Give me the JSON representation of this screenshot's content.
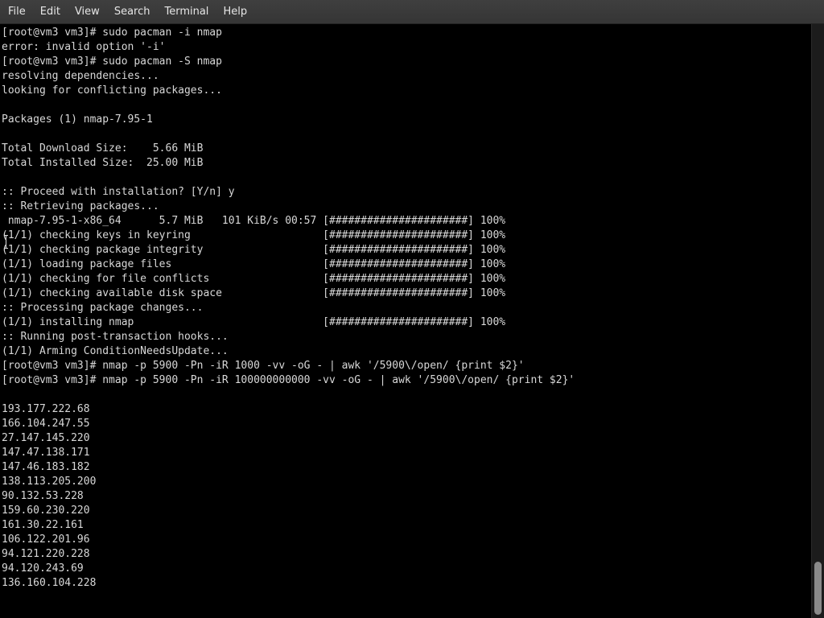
{
  "menubar": {
    "items": [
      "File",
      "Edit",
      "View",
      "Search",
      "Terminal",
      "Help"
    ]
  },
  "terminal": {
    "lines": [
      "[root@vm3 vm3]# sudo pacman -i nmap",
      "error: invalid option '-i'",
      "[root@vm3 vm3]# sudo pacman -S nmap",
      "resolving dependencies...",
      "looking for conflicting packages...",
      "",
      "Packages (1) nmap-7.95-1",
      "",
      "Total Download Size:    5.66 MiB",
      "Total Installed Size:  25.00 MiB",
      "",
      ":: Proceed with installation? [Y/n] y",
      ":: Retrieving packages...",
      " nmap-7.95-1-x86_64      5.7 MiB   101 KiB/s 00:57 [######################] 100%",
      "(1/1) checking keys in keyring                     [######################] 100%",
      "(1/1) checking package integrity                   [######################] 100%",
      "(1/1) loading package files                        [######################] 100%",
      "(1/1) checking for file conflicts                  [######################] 100%",
      "(1/1) checking available disk space                [######################] 100%",
      ":: Processing package changes...",
      "(1/1) installing nmap                              [######################] 100%",
      ":: Running post-transaction hooks...",
      "(1/1) Arming ConditionNeedsUpdate...",
      "[root@vm3 vm3]# nmap -p 5900 -Pn -iR 1000 -vv -oG - | awk '/5900\\/open/ {print $2}'",
      "[root@vm3 vm3]# nmap -p 5900 -Pn -iR 100000000000 -vv -oG - | awk '/5900\\/open/ {print $2}'",
      "",
      "193.177.222.68",
      "166.104.247.55",
      "27.147.145.220",
      "147.47.138.171",
      "147.46.183.182",
      "138.113.205.200",
      "90.132.53.228",
      "159.60.230.220",
      "161.30.22.161",
      "106.122.201.96",
      "94.121.220.228",
      "94.120.243.69",
      "136.160.104.228"
    ]
  },
  "colors": {
    "background": "#000000",
    "foreground": "#d8d8d8",
    "menubar": "#3a3a3a"
  }
}
